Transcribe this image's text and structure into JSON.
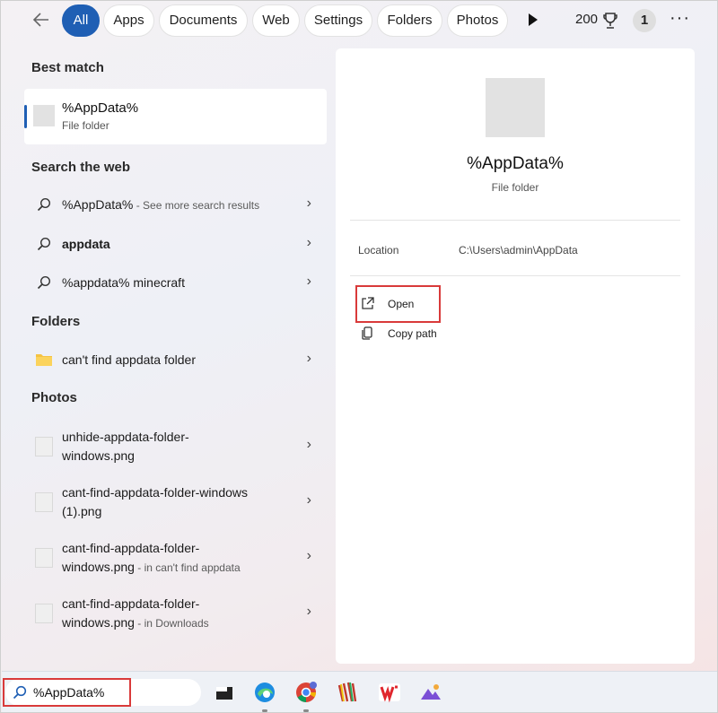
{
  "filters": {
    "back_icon": "arrow-left-icon",
    "tabs": [
      "All",
      "Apps",
      "Documents",
      "Web",
      "Settings",
      "Folders",
      "Photos"
    ],
    "active_tab": "All",
    "points": "200",
    "badge": "1",
    "more_label": "···"
  },
  "best_match": {
    "heading": "Best match",
    "title": "%AppData%",
    "subtitle": "File folder"
  },
  "web": {
    "heading": "Search the web",
    "items": [
      {
        "bold": "%AppData%",
        "muted": " - See more search results"
      },
      {
        "bold": "appdata",
        "muted": ""
      },
      {
        "bold": "%appdata% minecraft",
        "muted": ""
      }
    ]
  },
  "folders": {
    "heading": "Folders",
    "items": [
      {
        "label": "can't find appdata folder"
      }
    ]
  },
  "photos": {
    "heading": "Photos",
    "items": [
      {
        "line1": "unhide-appdata-folder-",
        "line2": "windows.png",
        "muted": ""
      },
      {
        "line1": "cant-find-appdata-folder-windows",
        "line2": "(1).png",
        "muted": ""
      },
      {
        "line1": "cant-find-appdata-folder-",
        "line2": "windows.png",
        "muted": " - in can't find appdata"
      },
      {
        "line1": "cant-find-appdata-folder-",
        "line2": "windows.png",
        "muted": " - in Downloads"
      }
    ]
  },
  "detail": {
    "title": "%AppData%",
    "subtitle": "File folder",
    "location_label": "Location",
    "location_value": "C:\\Users\\admin\\AppData",
    "actions": [
      "Open",
      "Copy path"
    ]
  },
  "taskbar": {
    "search_text": "%AppData%",
    "apps": [
      "file-explorer-icon",
      "edge-icon",
      "chrome-icon",
      "winrar-icon",
      "wps-office-icon",
      "photos-app-icon"
    ]
  },
  "colors": {
    "accent": "#1f5fb4",
    "highlight_box": "#d93a3a"
  }
}
